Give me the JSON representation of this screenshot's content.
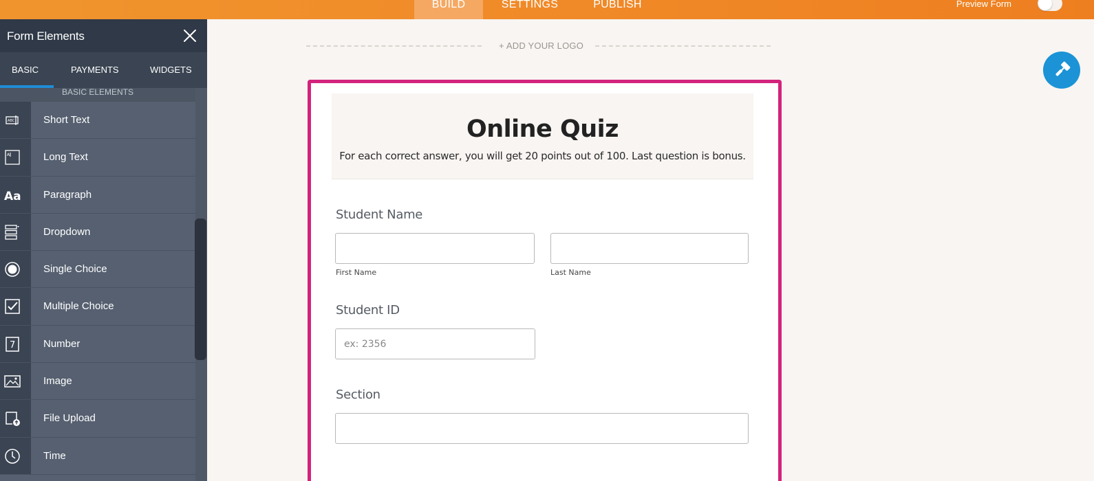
{
  "topbar": {
    "tabs": [
      {
        "label": "BUILD",
        "active": true
      },
      {
        "label": "SETTINGS",
        "active": false
      },
      {
        "label": "PUBLISH",
        "active": false
      }
    ],
    "preview_label": "Preview Form",
    "preview_on": false,
    "colors": {
      "bar": "#f08a28",
      "active_tab": "#f5a862"
    }
  },
  "sidebar": {
    "title": "Form Elements",
    "tabs": [
      {
        "label": "BASIC",
        "active": true
      },
      {
        "label": "PAYMENTS",
        "active": false
      },
      {
        "label": "WIDGETS",
        "active": false
      }
    ],
    "section_heading": "BASIC ELEMENTS",
    "items": [
      {
        "label": "Short Text",
        "icon": "short-text-icon"
      },
      {
        "label": "Long Text",
        "icon": "long-text-icon"
      },
      {
        "label": "Paragraph",
        "icon": "paragraph-icon"
      },
      {
        "label": "Dropdown",
        "icon": "dropdown-icon"
      },
      {
        "label": "Single Choice",
        "icon": "radio-icon"
      },
      {
        "label": "Multiple Choice",
        "icon": "checkbox-icon"
      },
      {
        "label": "Number",
        "icon": "number-icon"
      },
      {
        "label": "Image",
        "icon": "image-icon"
      },
      {
        "label": "File Upload",
        "icon": "file-upload-icon"
      },
      {
        "label": "Time",
        "icon": "clock-icon"
      }
    ],
    "colors": {
      "header": "#2f3947",
      "body": "#566070",
      "accent": "#1f8dd6"
    }
  },
  "canvas": {
    "add_logo": "+ ADD YOUR LOGO",
    "paint_button_icon": "paint-roller-icon",
    "form": {
      "title": "Online Quiz",
      "description": "For each correct answer, you will get 20 points out of 100. Last question is bonus.",
      "border_color": "#d3237c",
      "fields": {
        "student_name": {
          "label": "Student Name",
          "first_sublabel": "First Name",
          "last_sublabel": "Last Name",
          "first_value": "",
          "last_value": ""
        },
        "student_id": {
          "label": "Student ID",
          "placeholder": "ex: 2356",
          "value": ""
        },
        "section": {
          "label": "Section",
          "value": ""
        }
      }
    },
    "accent": "#1b93d6"
  }
}
